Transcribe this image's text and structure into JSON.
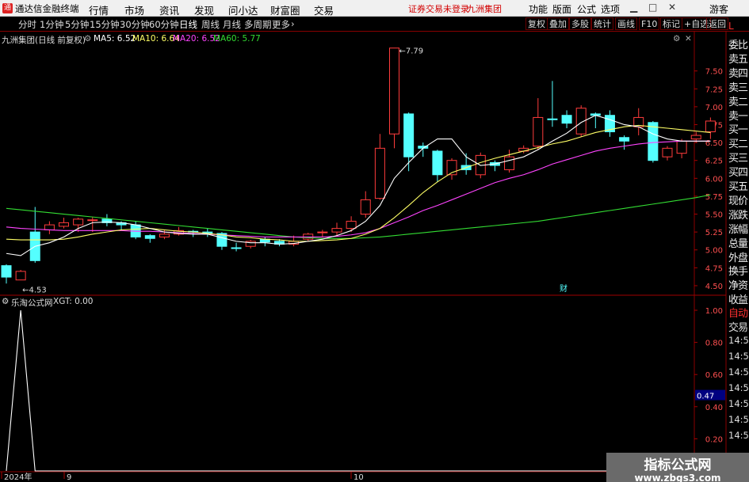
{
  "topbar": {
    "app_title": "通达信金融终端",
    "menu": [
      "行情",
      "市场",
      "资讯",
      "发现",
      "问小达",
      "财富圈",
      "交易"
    ],
    "login_notice": "证券交易未登录",
    "broker": "九洲集团",
    "right_menu": [
      "功能",
      "版面",
      "公式",
      "选项"
    ],
    "user": "游客"
  },
  "toolbar": {
    "periods": [
      "分时",
      "1分钟",
      "5分钟",
      "15分钟",
      "30分钟",
      "60分钟",
      "日线",
      "周线",
      "月线",
      "多周期",
      "更多"
    ],
    "active_period": "日线",
    "buttons": [
      "复权",
      "叠加",
      "多股",
      "统计",
      "画线",
      "F10",
      "标记",
      "+自选",
      "返回"
    ]
  },
  "kline": {
    "title": "九洲集团(日线 前复权)",
    "ma": [
      {
        "label": "MA5: 6.52",
        "color": "#ffffff"
      },
      {
        "label": "MA10: 6.64",
        "color": "#ffff66"
      },
      {
        "label": "MA20: 6.52",
        "color": "#ff44ff"
      },
      {
        "label": "MA60: 5.77",
        "color": "#33dd33"
      }
    ],
    "high_marker": "7.79",
    "low_marker": "4.53",
    "event_marker": "财",
    "price_ticks": [
      "7.50",
      "7.25",
      "7.00",
      "6.75",
      "6.50",
      "6.25",
      "6.00",
      "5.75",
      "5.50",
      "5.25",
      "5.00",
      "4.75",
      "4.50"
    ]
  },
  "indicator": {
    "title": "乐淘公式网",
    "value_label": "XGT: 0.00",
    "ticks": [
      "1.00",
      "0.80",
      "0.60",
      "0.40",
      "0.20"
    ],
    "cursor_value": "0.47"
  },
  "dates": [
    "2024年",
    "9",
    "10"
  ],
  "sidebar": {
    "top_label": "L",
    "items": [
      "委比",
      "卖五",
      "卖四",
      "卖三",
      "卖二",
      "卖一",
      "买一",
      "买二",
      "买三",
      "买四",
      "买五",
      "现价",
      "涨跌",
      "涨幅",
      "总量",
      "外盘",
      "换手",
      "净资",
      "收益"
    ],
    "auto_trade": [
      "自动",
      "交易"
    ],
    "times": [
      "14:56",
      "14:56",
      "14:56",
      "14:56",
      "14:56",
      "14:56",
      "14:56"
    ]
  },
  "watermark": {
    "title": "指标公式网",
    "url": "www.zbgs3.com"
  },
  "chart_data": {
    "type": "candlestick",
    "price_range": [
      4.4,
      7.85
    ],
    "ohlc": [
      [
        4.78,
        4.62,
        4.8,
        4.53
      ],
      [
        4.58,
        4.7,
        4.72,
        4.58
      ],
      [
        5.25,
        4.85,
        5.6,
        4.82
      ],
      [
        5.28,
        5.35,
        5.4,
        5.22
      ],
      [
        5.33,
        5.38,
        5.45,
        5.3
      ],
      [
        5.35,
        5.43,
        5.45,
        5.25
      ],
      [
        5.42,
        5.42,
        5.46,
        5.25
      ],
      [
        5.43,
        5.38,
        5.5,
        5.33
      ],
      [
        5.38,
        5.35,
        5.4,
        5.28
      ],
      [
        5.35,
        5.18,
        5.4,
        5.15
      ],
      [
        5.2,
        5.16,
        5.22,
        5.1
      ],
      [
        5.18,
        5.22,
        5.28,
        5.15
      ],
      [
        5.22,
        5.27,
        5.32,
        5.2
      ],
      [
        5.26,
        5.25,
        5.28,
        5.18
      ],
      [
        5.25,
        5.22,
        5.3,
        5.18
      ],
      [
        5.23,
        5.05,
        5.25,
        5.0
      ],
      [
        5.03,
        5.02,
        5.1,
        4.98
      ],
      [
        5.05,
        5.12,
        5.14,
        5.02
      ],
      [
        5.15,
        5.11,
        5.18,
        5.05
      ],
      [
        5.12,
        5.08,
        5.15,
        5.05
      ],
      [
        5.08,
        5.12,
        5.2,
        5.05
      ],
      [
        5.15,
        5.22,
        5.24,
        5.12
      ],
      [
        5.25,
        5.25,
        5.28,
        5.18
      ],
      [
        5.25,
        5.3,
        5.38,
        5.2
      ],
      [
        5.3,
        5.4,
        5.47,
        5.25
      ],
      [
        5.5,
        5.7,
        5.82,
        5.45
      ],
      [
        5.72,
        6.42,
        6.62,
        5.7
      ],
      [
        6.62,
        7.82,
        7.82,
        6.42
      ],
      [
        6.9,
        6.3,
        6.92,
        6.1
      ],
      [
        6.45,
        6.42,
        6.5,
        6.3
      ],
      [
        6.38,
        6.05,
        6.4,
        5.95
      ],
      [
        6.05,
        6.25,
        6.28,
        5.98
      ],
      [
        6.18,
        6.12,
        6.35,
        6.05
      ],
      [
        6.05,
        6.32,
        6.36,
        6.0
      ],
      [
        6.22,
        6.18,
        6.25,
        6.1
      ],
      [
        6.12,
        6.3,
        6.4,
        6.08
      ],
      [
        6.38,
        6.42,
        6.46,
        6.35
      ],
      [
        6.45,
        6.85,
        7.12,
        6.4
      ],
      [
        6.83,
        6.82,
        7.36,
        6.72
      ],
      [
        6.88,
        6.77,
        6.95,
        6.7
      ],
      [
        6.62,
        6.98,
        7.02,
        6.58
      ],
      [
        6.9,
        6.88,
        6.92,
        6.7
      ],
      [
        6.88,
        6.65,
        6.95,
        6.58
      ],
      [
        6.57,
        6.52,
        6.6,
        6.4
      ],
      [
        6.72,
        6.85,
        6.98,
        6.6
      ],
      [
        6.78,
        6.25,
        6.8,
        6.22
      ],
      [
        6.3,
        6.42,
        6.45,
        6.25
      ],
      [
        6.35,
        6.52,
        6.55,
        6.28
      ],
      [
        6.55,
        6.6,
        6.65,
        6.5
      ],
      [
        6.65,
        6.8,
        6.85,
        6.55
      ]
    ],
    "ma5": [
      4.95,
      4.92,
      5.05,
      5.1,
      5.18,
      5.3,
      5.38,
      5.39,
      5.38,
      5.35,
      5.3,
      5.25,
      5.23,
      5.22,
      5.22,
      5.17,
      5.12,
      5.1,
      5.1,
      5.08,
      5.09,
      5.12,
      5.15,
      5.2,
      5.27,
      5.4,
      5.62,
      6.0,
      6.22,
      6.42,
      6.55,
      6.55,
      6.3,
      6.18,
      6.2,
      6.25,
      6.3,
      6.4,
      6.52,
      6.63,
      6.78,
      6.88,
      6.82,
      6.75,
      6.72,
      6.62,
      6.55,
      6.52,
      6.52,
      6.52
    ],
    "ma10": [
      5.15,
      5.14,
      5.14,
      5.14,
      5.15,
      5.18,
      5.22,
      5.25,
      5.28,
      5.29,
      5.3,
      5.28,
      5.26,
      5.25,
      5.23,
      5.21,
      5.18,
      5.17,
      5.15,
      5.14,
      5.12,
      5.12,
      5.13,
      5.14,
      5.16,
      5.22,
      5.3,
      5.45,
      5.62,
      5.8,
      5.95,
      6.08,
      6.15,
      6.22,
      6.28,
      6.33,
      6.38,
      6.43,
      6.48,
      6.52,
      6.58,
      6.64,
      6.68,
      6.72,
      6.74,
      6.72,
      6.7,
      6.68,
      6.66,
      6.64
    ],
    "ma20": [
      5.32,
      5.3,
      5.29,
      5.28,
      5.27,
      5.27,
      5.27,
      5.27,
      5.27,
      5.26,
      5.26,
      5.25,
      5.24,
      5.23,
      5.22,
      5.21,
      5.2,
      5.19,
      5.18,
      5.18,
      5.18,
      5.18,
      5.18,
      5.19,
      5.21,
      5.24,
      5.3,
      5.38,
      5.46,
      5.55,
      5.62,
      5.7,
      5.78,
      5.86,
      5.94,
      6.0,
      6.05,
      6.12,
      6.2,
      6.26,
      6.32,
      6.38,
      6.42,
      6.45,
      6.48,
      6.5,
      6.51,
      6.52,
      6.52,
      6.52
    ],
    "ma60": [
      5.58,
      5.56,
      5.54,
      5.52,
      5.5,
      5.48,
      5.46,
      5.44,
      5.42,
      5.4,
      5.38,
      5.36,
      5.34,
      5.32,
      5.3,
      5.28,
      5.26,
      5.24,
      5.22,
      5.2,
      5.18,
      5.17,
      5.16,
      5.16,
      5.16,
      5.17,
      5.18,
      5.2,
      5.22,
      5.24,
      5.26,
      5.28,
      5.3,
      5.32,
      5.34,
      5.36,
      5.38,
      5.4,
      5.43,
      5.46,
      5.49,
      5.52,
      5.55,
      5.58,
      5.61,
      5.64,
      5.67,
      5.7,
      5.73,
      5.77
    ],
    "xgt": [
      0,
      1,
      0,
      0,
      0,
      0,
      0,
      0,
      0,
      0,
      0,
      0,
      0,
      0,
      0,
      0,
      0,
      0,
      0,
      0,
      0,
      0,
      0,
      0,
      0,
      0,
      0,
      0,
      0,
      0,
      0,
      0,
      0,
      0,
      0,
      0,
      0,
      0,
      0,
      0,
      0,
      0,
      0,
      0,
      0,
      0,
      0,
      0,
      0,
      0
    ]
  }
}
